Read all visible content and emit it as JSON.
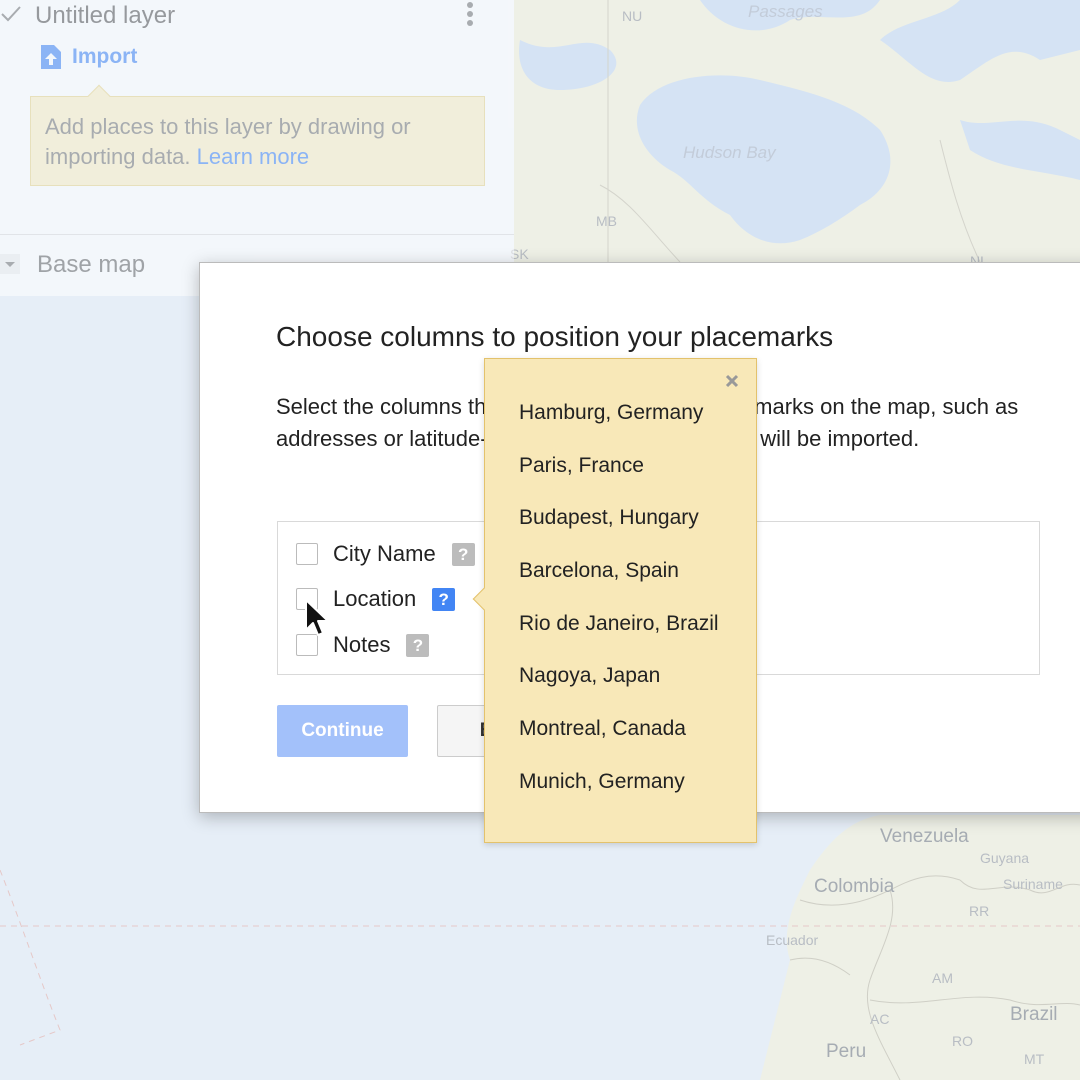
{
  "colors": {
    "accent": "#4285f4",
    "hint_background": "#fbefc5",
    "popover_background": "#f8e8b8",
    "continue_disabled": "#a3c1fa"
  },
  "map": {
    "labels": {
      "nu": "NU",
      "passages": "Passages",
      "hudson_bay": "Hudson Bay",
      "mb": "MB",
      "sk": "SK",
      "nl": "NL",
      "venezuela": "Venezuela",
      "guyana": "Guyana",
      "suriname": "Suriname",
      "colombia": "Colombia",
      "rr": "RR",
      "ecuador": "Ecuador",
      "am": "AM",
      "ac": "AC",
      "brazil": "Brazil",
      "ro": "RO",
      "peru": "Peru",
      "mt": "MT"
    }
  },
  "panel": {
    "layer_title": "Untitled layer",
    "import_label": "Import",
    "hint_text": "Add places to this layer by drawing or importing data.",
    "hint_link": "Learn more",
    "base_map_label": "Base map",
    "icons": {
      "layer_check": "checkbox-checked-icon",
      "menu": "more-vert-icon",
      "import": "file-upload-icon",
      "base_toggle": "caret-down-icon"
    }
  },
  "dialog": {
    "title": "Choose columns to position your placemarks",
    "description": "Select the columns that tell us where to put placemarks on the map, such as addresses or latitude-longitude pairs. All columns will be imported.",
    "columns": [
      {
        "label": "City Name",
        "help": "?"
      },
      {
        "label": "Location",
        "help": "?"
      },
      {
        "label": "Notes",
        "help": "?"
      }
    ],
    "continue_label": "Continue",
    "back_label": "Back"
  },
  "popover": {
    "close_icon": "close-icon",
    "items": [
      "Hamburg, Germany",
      "Paris, France",
      "Budapest, Hungary",
      "Barcelona, Spain",
      "Rio de Janeiro, Brazil",
      "Nagoya, Japan",
      "Montreal, Canada",
      "Munich, Germany"
    ]
  }
}
